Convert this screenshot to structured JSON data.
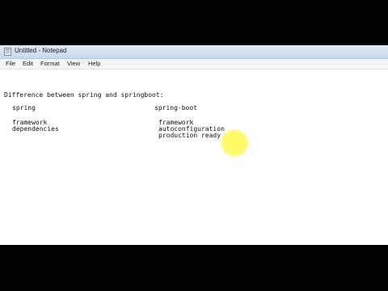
{
  "window": {
    "title": "Untitled - Notepad"
  },
  "menu": {
    "items": [
      "File",
      "Edit",
      "Format",
      "View",
      "Help"
    ]
  },
  "document": {
    "heading": "Difference between spring and springboot:",
    "spring_header": "spring",
    "springboot_header": "spring-boot",
    "spring_items": [
      "framework",
      "dependencies"
    ],
    "springboot_items": [
      "framework",
      "autoconfiguration",
      "production ready"
    ]
  },
  "icons": {
    "app": "notepad-icon"
  },
  "colors": {
    "titlebar": "#c9d9ee",
    "highlight": "#fff85a"
  }
}
